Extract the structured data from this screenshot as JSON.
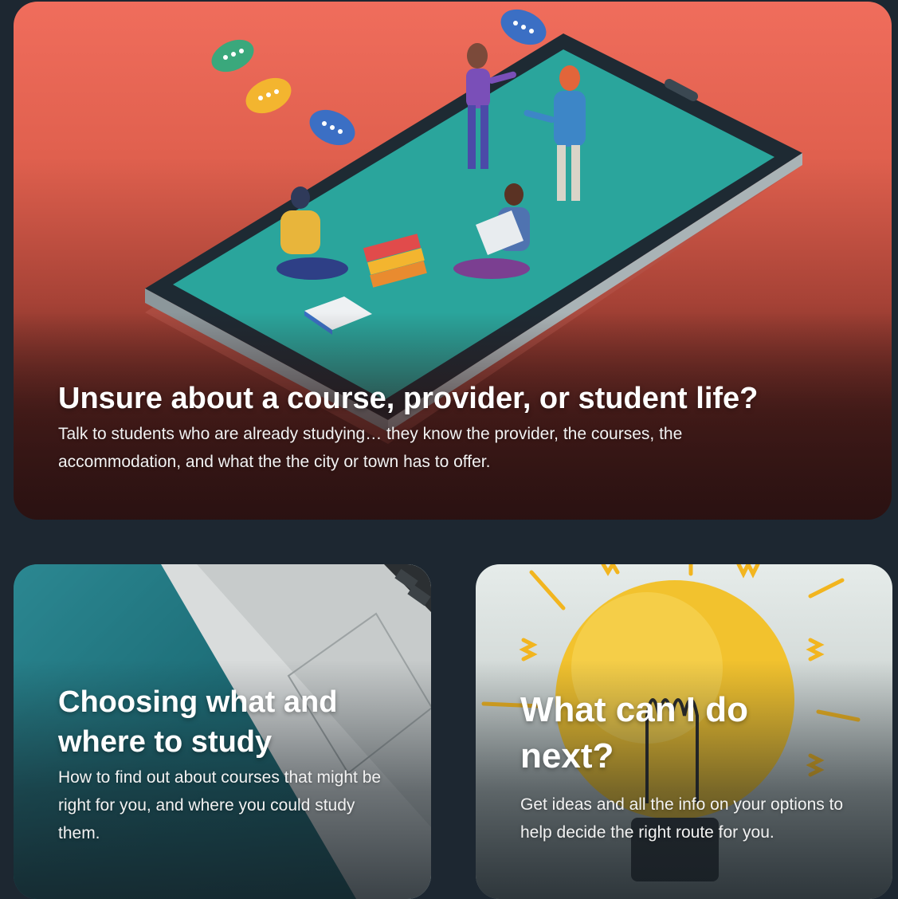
{
  "cards": [
    {
      "title": "Unsure about a course, provider, or student life?",
      "description": "Talk to students who are already studying… they know the provider, the courses, the accommodation, and what the the city or town has to offer."
    },
    {
      "title": "Choosing what and where to study",
      "description": "How to find out about courses that might be right for you, and where you could study them."
    },
    {
      "title": "What can I do next?",
      "description": "Get ideas and all the info on your options to help decide the right route for you."
    }
  ],
  "colors": {
    "page_background": "#1d2731",
    "hero_top": "#f06d5c",
    "hero_bottom": "#3a1a19",
    "study_teal": "#1f6f7a",
    "bulb_yellow": "#f2c22e"
  }
}
